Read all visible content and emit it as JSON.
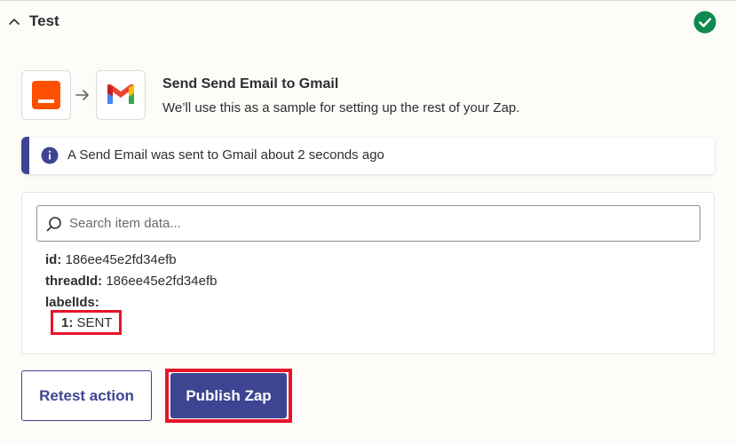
{
  "section": {
    "title": "Test",
    "collapse_icon": "chevron-up-icon",
    "status_icon": "check-circle-icon",
    "status_color": "#0e8a4e"
  },
  "step": {
    "source_icon": "email-by-zapier-icon",
    "source_color": "#ff4f00",
    "target_icon": "gmail-icon",
    "title": "Send Send Email to Gmail",
    "subtitle": "We’ll use this as a sample for setting up the rest of your Zap."
  },
  "info_banner": {
    "icon": "info-icon",
    "text": "A Send Email was sent to Gmail about 2 seconds ago",
    "accent": "#3d4592"
  },
  "search": {
    "placeholder": "Search item data..."
  },
  "item_data": {
    "id": {
      "key": "id:",
      "value": "186ee45e2fd34efb"
    },
    "threadId": {
      "key": "threadId:",
      "value": "186ee45e2fd34efb"
    },
    "labelIds": {
      "key": "labelIds:",
      "items": [
        {
          "key": "1:",
          "value": "SENT"
        }
      ]
    }
  },
  "buttons": {
    "retest": "Retest action",
    "publish": "Publish Zap"
  },
  "colors": {
    "primary": "#3d4592",
    "highlight": "#e8142a"
  }
}
